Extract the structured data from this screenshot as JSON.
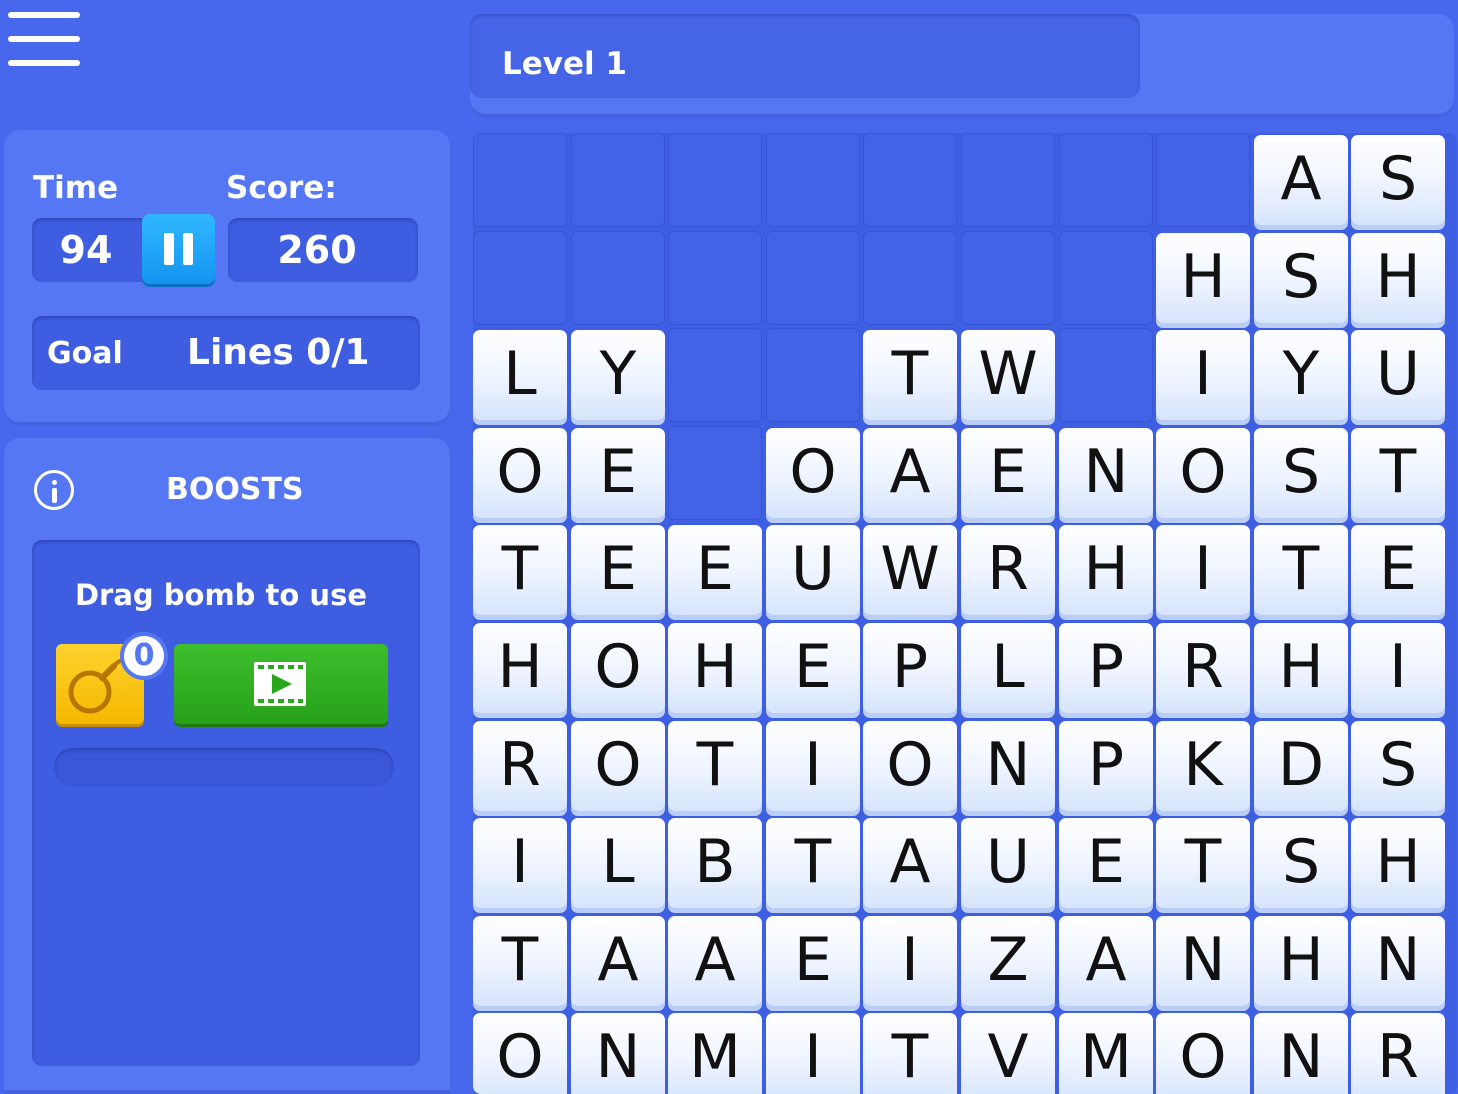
{
  "header": {
    "level_label": "Level 1"
  },
  "stats": {
    "time_label": "Time",
    "time_value": "94",
    "score_label": "Score:",
    "score_value": "260",
    "goal_label": "Goal",
    "goal_value": "Lines 0/1"
  },
  "boosts": {
    "title": "BOOSTS",
    "hint": "Drag bomb to use",
    "bomb_count": "0"
  },
  "icons": {
    "menu": "hamburger-menu-icon",
    "pause": "pause-icon",
    "info": "info-icon",
    "bomb": "bomb-icon",
    "video": "video-play-icon"
  },
  "colors": {
    "background": "#4767ec",
    "panel": "#5577f3",
    "pause_button": "#1ba3f7",
    "bomb_button": "#fcc419",
    "video_button": "#31b024",
    "tile": "#ffffff"
  },
  "board": {
    "columns": 10,
    "rows": [
      [
        "",
        "",
        "",
        "",
        "",
        "",
        "",
        "",
        "A",
        "S"
      ],
      [
        "",
        "",
        "",
        "",
        "",
        "",
        "",
        "H",
        "S",
        "H"
      ],
      [
        "L",
        "Y",
        "",
        "",
        "T",
        "W",
        "",
        "I",
        "Y",
        "U"
      ],
      [
        "O",
        "E",
        "",
        "O",
        "A",
        "E",
        "N",
        "O",
        "S",
        "T"
      ],
      [
        "T",
        "E",
        "E",
        "U",
        "W",
        "R",
        "H",
        "I",
        "T",
        "E"
      ],
      [
        "H",
        "O",
        "H",
        "E",
        "P",
        "L",
        "P",
        "R",
        "H",
        "I"
      ],
      [
        "R",
        "O",
        "T",
        "I",
        "O",
        "N",
        "P",
        "K",
        "D",
        "S"
      ],
      [
        "I",
        "L",
        "B",
        "T",
        "A",
        "U",
        "E",
        "T",
        "S",
        "H"
      ],
      [
        "T",
        "A",
        "A",
        "E",
        "I",
        "Z",
        "A",
        "N",
        "H",
        "N"
      ],
      [
        "O",
        "N",
        "M",
        "I",
        "T",
        "V",
        "M",
        "O",
        "N",
        "R"
      ]
    ]
  }
}
